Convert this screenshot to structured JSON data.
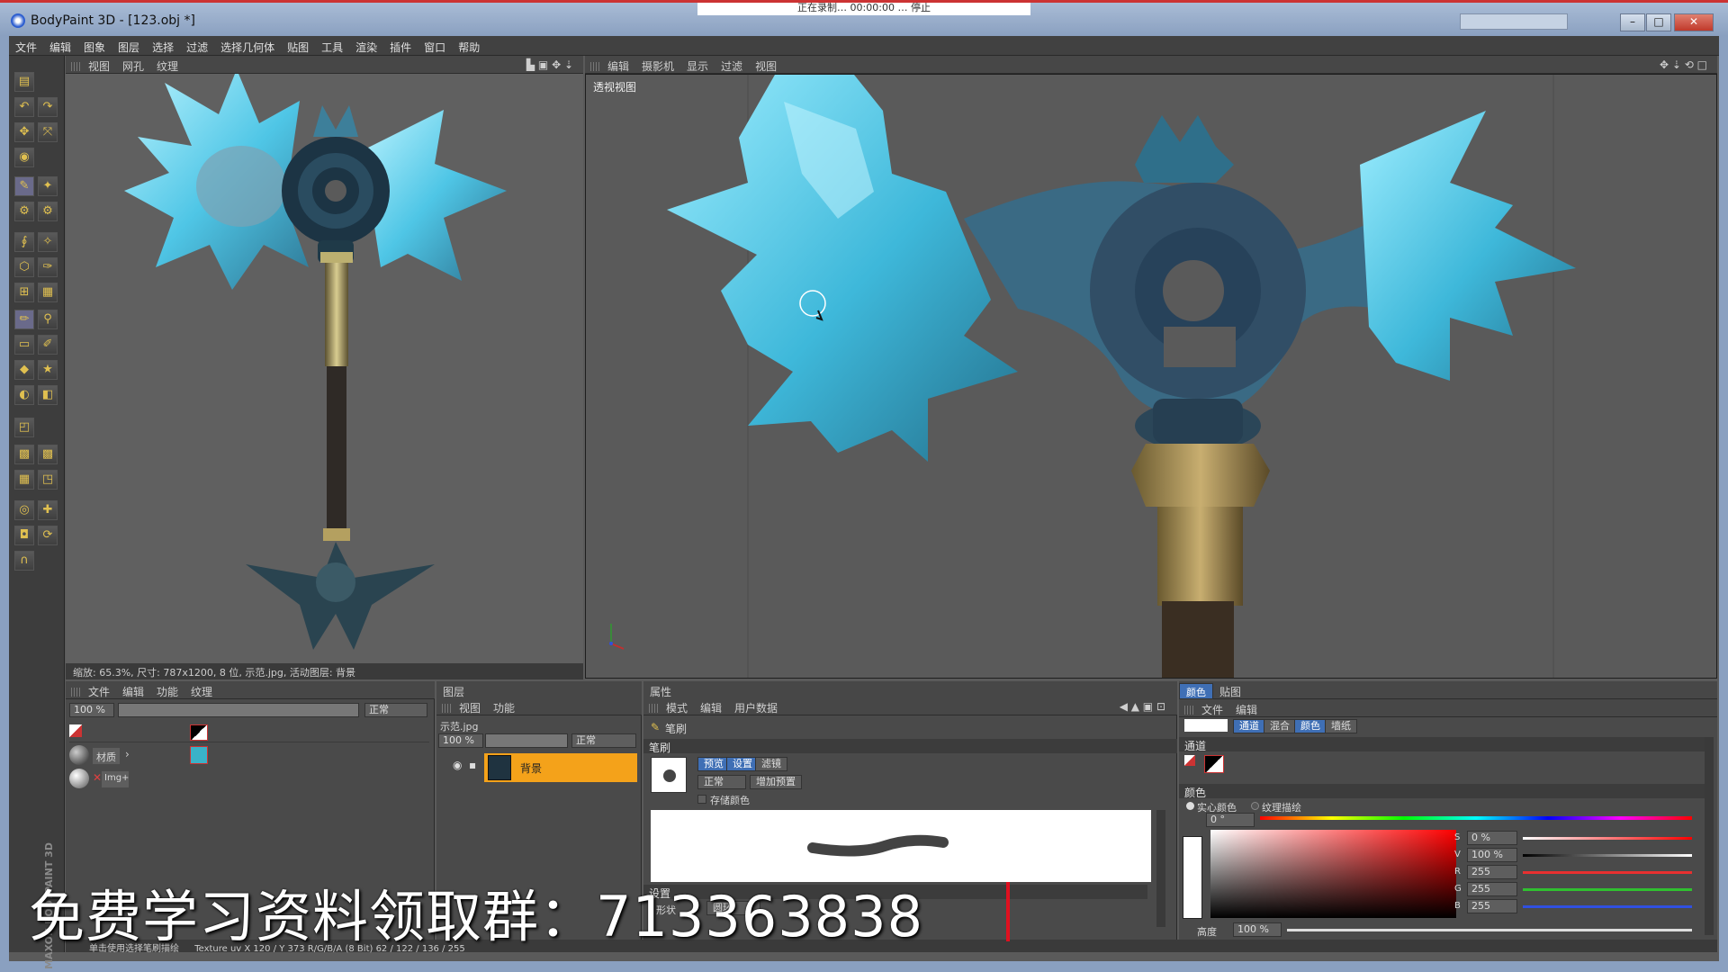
{
  "window": {
    "title": "BodyPaint 3D - [123.obj *]",
    "recording_bar": "正在录制… 00:00:00 … 停止",
    "minimize": "–",
    "maximize": "□",
    "close": "✕"
  },
  "menu": [
    "文件",
    "编辑",
    "图象",
    "图层",
    "选择",
    "过滤",
    "选择几何体",
    "贴图",
    "工具",
    "渲染",
    "插件",
    "窗口",
    "帮助"
  ],
  "uv_view": {
    "menu": [
      "视图",
      "网孔",
      "纹理"
    ],
    "status": "缩放: 65.3%, 尺寸: 787x1200, 8 位, 示范.jpg, 活动图层: 背景"
  },
  "view3d": {
    "menu": [
      "编辑",
      "摄影机",
      "显示",
      "过滤",
      "视图"
    ],
    "label": "透视视图"
  },
  "texture_panel": {
    "menu": [
      "文件",
      "编辑",
      "功能",
      "纹理"
    ],
    "opacity": "100 %",
    "mode": "正常",
    "rows": [
      {
        "name": "材质"
      },
      {
        "name": "Img+"
      }
    ]
  },
  "layer_panel": {
    "title": "图层",
    "menu": [
      "视图",
      "功能"
    ],
    "file": "示范.jpg",
    "opacity": "100 %",
    "mode": "正常",
    "layer_name": "背景"
  },
  "attributes_panel": {
    "title": "属性",
    "menu": [
      "模式",
      "编辑",
      "用户数据"
    ],
    "tool": "笔刷",
    "section": "笔刷",
    "tabs": [
      "预览",
      "设置",
      "滤镜"
    ],
    "blend": "正常",
    "add_preset": "增加预置",
    "store_color": "存储颜色",
    "settings_label": "设置",
    "shape_label": "形状",
    "shape_value": "圆环"
  },
  "color_panel": {
    "tabs": [
      "颜色",
      "贴图"
    ],
    "menu": [
      "文件",
      "编辑"
    ],
    "mode_tabs": [
      "通道",
      "混合",
      "颜色",
      "墙纸"
    ],
    "channels_label": "通道",
    "color_label": "颜色",
    "solid_color": "实心颜色",
    "texture_paint": "纹理描绘",
    "hue": "0 °",
    "s": {
      "label": "S",
      "value": "0 %"
    },
    "v": {
      "label": "V",
      "value": "100 %"
    },
    "r": {
      "label": "R",
      "value": "255"
    },
    "g": {
      "label": "G",
      "value": "255"
    },
    "b": {
      "label": "B",
      "value": "255"
    },
    "height_label": "高度",
    "height_value": "100 %",
    "accent_red": "#e83030",
    "accent_green": "#30c030",
    "accent_blue": "#3050e0"
  },
  "status_bar": {
    "hint": "单击使用选择笔刷描绘",
    "info": "Texture uv   X 120 / Y 373 R/G/B/A (8 Bit) 62 / 122 / 136 / 255"
  },
  "watermark": "免费学习资料领取群：713363838",
  "brand": "MAXON BODYPAINT 3D",
  "colors": {
    "selected_layer": "#f4a21a",
    "active_button": "#3f6fb5"
  }
}
